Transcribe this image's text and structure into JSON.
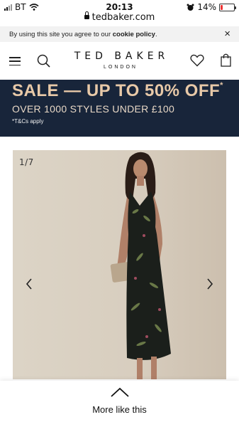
{
  "status_bar": {
    "carrier": "BT",
    "time": "20:13",
    "battery": "14%"
  },
  "browser": {
    "url": "tedbaker.com"
  },
  "cookie_notice": {
    "text_prefix": "By using this site you agree to our ",
    "link": "cookie policy",
    "text_suffix": ".",
    "close": "×"
  },
  "header": {
    "brand_name": "TED BAKER",
    "brand_sub": "LONDON",
    "icons": [
      "hamburger-menu-icon",
      "search-icon",
      "heart-icon",
      "shopping-bag-icon"
    ]
  },
  "sale_banner": {
    "headline": "SALE — UP TO 50% OFF",
    "asterisk": "*",
    "subline": "OVER 1000 STYLES UNDER £100",
    "terms": "*T&Cs apply",
    "colors": {
      "background": "#18253a",
      "text": "#e8c9a8"
    }
  },
  "gallery": {
    "counter": "1/7",
    "prev_icon": "chevron-left-icon",
    "next_icon": "chevron-right-icon"
  },
  "more_like_this": {
    "label": "More like this",
    "icon": "chevron-up-icon"
  }
}
